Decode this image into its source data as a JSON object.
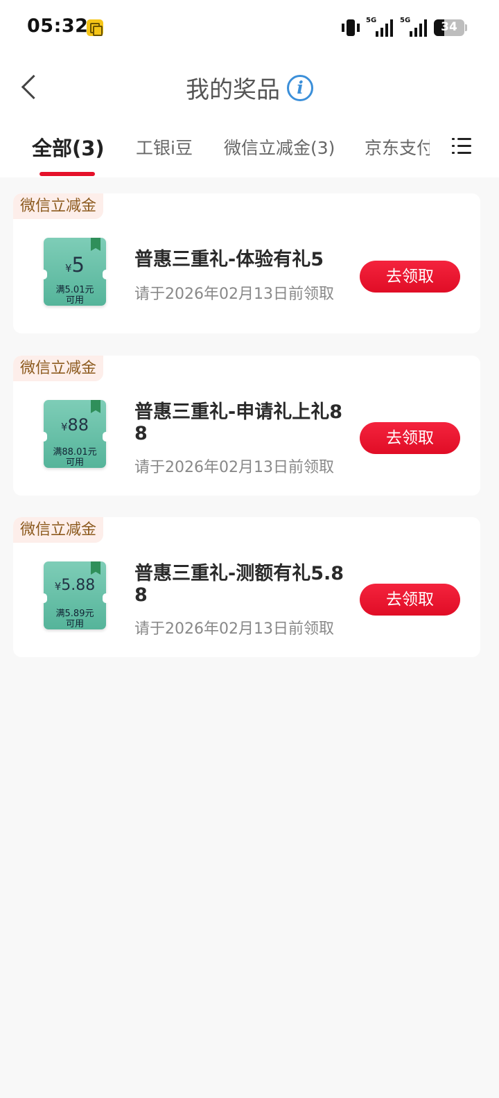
{
  "status_bar": {
    "time": "05:32",
    "network_1": "5G",
    "network_2": "5G",
    "battery": "34",
    "battery_level_percent": 34
  },
  "header": {
    "title": "我的奖品",
    "info_icon": "info-icon"
  },
  "tabs": [
    {
      "label": "全部(3)",
      "active": true
    },
    {
      "label": "工银i豆",
      "active": false
    },
    {
      "label": "微信立减金(3)",
      "active": false
    },
    {
      "label": "京东支付",
      "active": false
    }
  ],
  "colors": {
    "accent": "#e5112a",
    "tag_bg": "#fdeeea",
    "tag_text": "#8c5a1e",
    "coupon": "#6cc2aa"
  },
  "prizes": [
    {
      "tag": "微信立减金",
      "coupon_amount": "5",
      "coupon_condition_1": "满5.01元",
      "coupon_condition_2": "可用",
      "title": "普惠三重礼-体验有礼5",
      "deadline": "请于2026年02月13日前领取",
      "button": "去领取"
    },
    {
      "tag": "微信立减金",
      "coupon_amount": "88",
      "coupon_condition_1": "满88.01元",
      "coupon_condition_2": "可用",
      "title": "普惠三重礼-申请礼上礼88",
      "deadline": "请于2026年02月13日前领取",
      "button": "去领取"
    },
    {
      "tag": "微信立减金",
      "coupon_amount": "5.88",
      "coupon_condition_1": "满5.89元",
      "coupon_condition_2": "可用",
      "title": "普惠三重礼-测额有礼5.88",
      "deadline": "请于2026年02月13日前领取",
      "button": "去领取"
    }
  ]
}
